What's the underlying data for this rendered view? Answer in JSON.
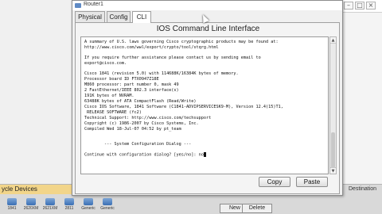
{
  "window": {
    "title": "Router1",
    "tabs": [
      {
        "label": "Physical"
      },
      {
        "label": "Config"
      },
      {
        "label": "CLI"
      }
    ],
    "active_tab": "CLI",
    "heading": "IOS Command Line Interface"
  },
  "terminal": {
    "lines": [
      "A summary of U.S. laws governing Cisco cryptographic products may be found at:",
      "http://www.cisco.com/wwl/export/crypto/tool/stqrg.html",
      "",
      "If you require further assistance please contact us by sending email to",
      "export@cisco.com.",
      "",
      "Cisco 1841 (revision 5.0) with 114688K/16384K bytes of memory.",
      "Processor board ID FTX0947Z18E",
      "M860 processor: part number 0, mask 49",
      "2 FastEthernet/IEEE 802.3 interface(s)",
      "191K bytes of NVRAM.",
      "63488K bytes of ATA CompactFlash (Read/Write)",
      "Cisco IOS Software, 1841 Software (C1841-ADVIPSERVICESK9-M), Version 12.4(15)T1,",
      " RELEASE SOFTWARE (fc2)",
      "Technical Support: http://www.cisco.com/techsupport",
      "Copyright (c) 1986-2007 by Cisco Systems, Inc.",
      "Compiled Wed 18-Jul-07 04:52 by pt_team",
      "",
      "",
      "        --- System Configuration Dialog ---",
      "",
      "Continue with configuration dialog? [yes/no]: no"
    ]
  },
  "buttons": {
    "copy": "Copy",
    "paste": "Paste"
  },
  "background": {
    "panel_title": "ycle Devices",
    "destination_label": "Destination",
    "devices": [
      "1841",
      "2620XM",
      "2621XM",
      "2811",
      "Generic",
      "Generic"
    ],
    "new_button": "New",
    "delete_button": "Delete"
  }
}
